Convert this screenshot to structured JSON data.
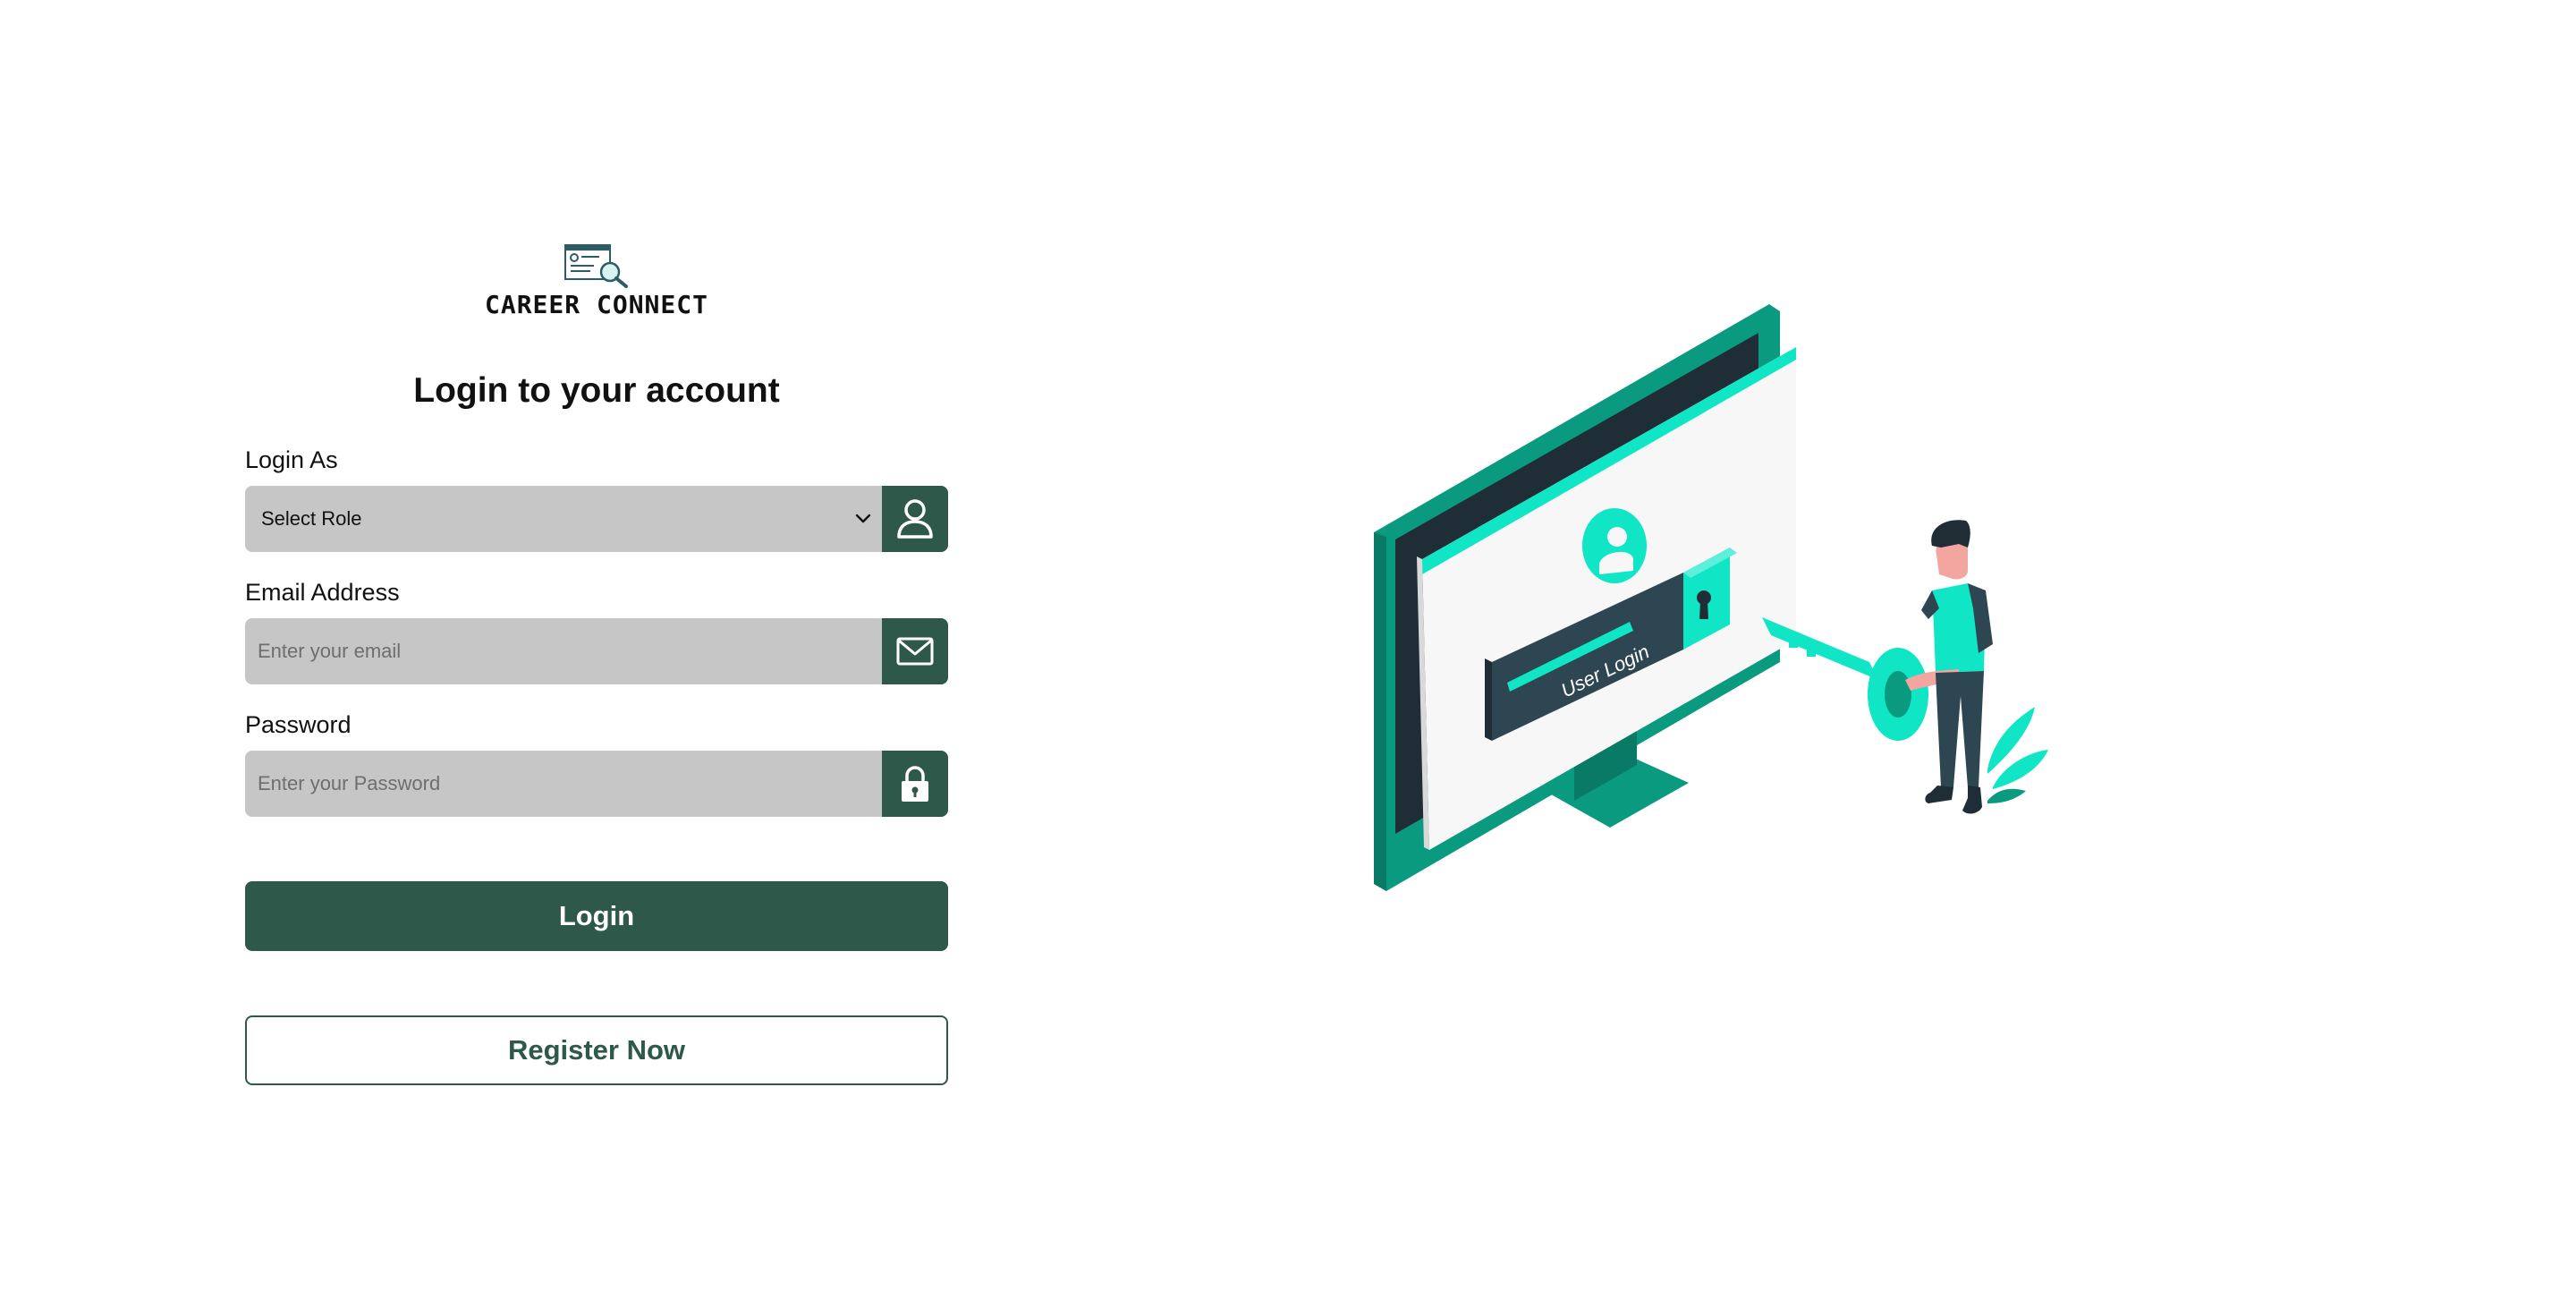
{
  "brand": {
    "name": "CAREER CONNECT",
    "logo_icon": "resume-search-icon"
  },
  "form": {
    "title": "Login to your account",
    "role": {
      "label": "Login As",
      "selected": "Select Role",
      "icon": "user-icon"
    },
    "email": {
      "label": "Email Address",
      "placeholder": "Enter your email",
      "value": "",
      "icon": "mail-icon"
    },
    "password": {
      "label": "Password",
      "placeholder": "Enter your Password",
      "value": "",
      "icon": "lock-icon"
    },
    "login_label": "Login",
    "register_label": "Register Now"
  },
  "illustration": {
    "screen_text": "User Login"
  },
  "colors": {
    "primary": "#2e5849",
    "input_bg": "#c6c6c6",
    "accent": "#0fe0c0"
  }
}
